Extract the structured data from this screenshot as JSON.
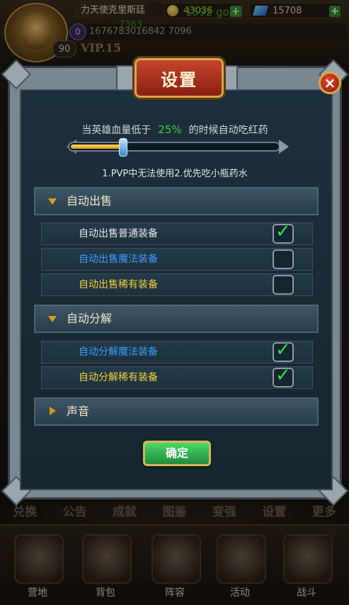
{
  "hud": {
    "player_name": "力天使克里斯廷",
    "gold": "43036",
    "gold_overlay": "1592 gold",
    "gems": "15708",
    "exp_icon": "0",
    "exp": "1676783016842 7096",
    "exp_overlay": "7363",
    "level": "90",
    "vip": "VIP.15"
  },
  "dialog": {
    "title": "设置",
    "close_symbol": "×",
    "hp_prefix": "当英雄血量低于",
    "hp_percent": "25%",
    "hp_suffix": "的时候自动吃红药",
    "hp_value_fraction": 0.25,
    "tip": "1.PVP中无法使用2.优先吃小瓶药水",
    "sections": {
      "auto_sell": {
        "label": "自动出售",
        "options": [
          {
            "label": "自动出售普通装备",
            "checked": true
          },
          {
            "label": "自动出售魔法装备",
            "checked": false
          },
          {
            "label": "自动出售稀有装备",
            "checked": false
          }
        ]
      },
      "auto_decompose": {
        "label": "自动分解",
        "options": [
          {
            "label": "自动分解魔法装备",
            "checked": true
          },
          {
            "label": "自动分解稀有装备",
            "checked": true
          }
        ]
      },
      "sound": {
        "label": "声音"
      }
    },
    "check_symbol": "✓",
    "confirm_label": "确定"
  },
  "menu": [
    "兑换",
    "公告",
    "成就",
    "图鉴",
    "变强",
    "设置",
    "更多"
  ],
  "nav": [
    "营地",
    "背包",
    "阵容",
    "活动",
    "战斗"
  ],
  "colors": {
    "percent_green": "#3cd23c",
    "magic_blue": "#3a9bff",
    "rare_yellow": "#f0d23a",
    "check_green": "#33e04a",
    "title_red": "#c4452c"
  },
  "icons": [
    "coin-icon",
    "gem-icon",
    "plus-icon",
    "close-icon",
    "checkmark-icon",
    "triangle-down-icon",
    "triangle-right-icon"
  ]
}
